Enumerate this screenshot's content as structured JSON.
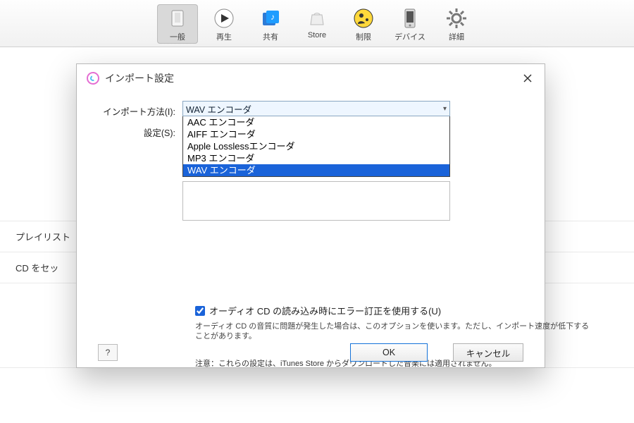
{
  "toolbar": {
    "items": [
      {
        "label": "一般",
        "selected": true
      },
      {
        "label": "再生"
      },
      {
        "label": "共有"
      },
      {
        "label": "Store"
      },
      {
        "label": "制限"
      },
      {
        "label": "デバイス"
      },
      {
        "label": "詳細"
      }
    ]
  },
  "background_rows": [
    "プレイリスト",
    "CD をセッ"
  ],
  "dialog": {
    "title": "インポート設定",
    "labels": {
      "method": "インポート方法(I):",
      "settings": "設定(S):"
    },
    "combo_value": "WAV エンコーダ",
    "options": [
      "AAC エンコーダ",
      "AIFF エンコーダ",
      "Apple Losslessエンコーダ",
      "MP3 エンコーダ",
      "WAV エンコーダ"
    ],
    "selected_option_index": 4,
    "checkbox": {
      "label": "オーディオ CD の読み込み時にエラー訂正を使用する(U)",
      "checked": true,
      "desc": "オーディオ CD の音質に問題が発生した場合は、このオプションを使います。ただし、インポート速度が低下することがあります。"
    },
    "note": "注意：これらの設定は、iTunes Store からダウンロードした音楽には適用されません。",
    "buttons": {
      "help": "?",
      "ok": "OK",
      "cancel": "キャンセル"
    }
  }
}
